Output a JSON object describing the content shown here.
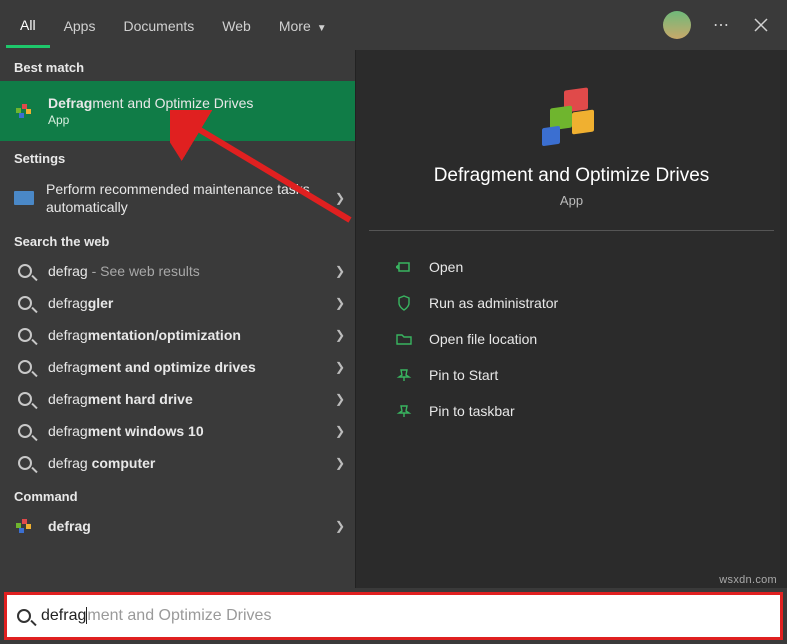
{
  "tabs": {
    "all": "All",
    "apps": "Apps",
    "documents": "Documents",
    "web": "Web",
    "more": "More"
  },
  "sections": {
    "best_match": "Best match",
    "settings": "Settings",
    "search_web": "Search the web",
    "command": "Command"
  },
  "best_match_item": {
    "title_prefix": "Defrag",
    "title_rest": "ment and Optimize Drives",
    "subtitle": "App"
  },
  "settings_item": {
    "label": "Perform recommended maintenance tasks automatically"
  },
  "web": [
    {
      "q": "defrag",
      "hint": " - See web results"
    },
    {
      "pre": "defrag",
      "bold": "gler"
    },
    {
      "pre": "defrag",
      "bold": "mentation/optimization"
    },
    {
      "pre": "defrag",
      "bold": "ment and optimize drives"
    },
    {
      "pre": "defrag",
      "bold": "ment hard drive"
    },
    {
      "pre": "defrag",
      "bold": "ment windows 10"
    },
    {
      "pre": "defrag",
      "bold2": " computer"
    }
  ],
  "command_item": {
    "pre": "",
    "bold": "defrag"
  },
  "detail": {
    "title": "Defragment and Optimize Drives",
    "subtitle": "App",
    "actions": {
      "open": "Open",
      "runas": "Run as administrator",
      "openloc": "Open file location",
      "pinstart": "Pin to Start",
      "pintaskbar": "Pin to taskbar"
    }
  },
  "search": {
    "typed": "defrag",
    "completion": "ment and Optimize Drives"
  },
  "watermark": "wsxdn.com"
}
